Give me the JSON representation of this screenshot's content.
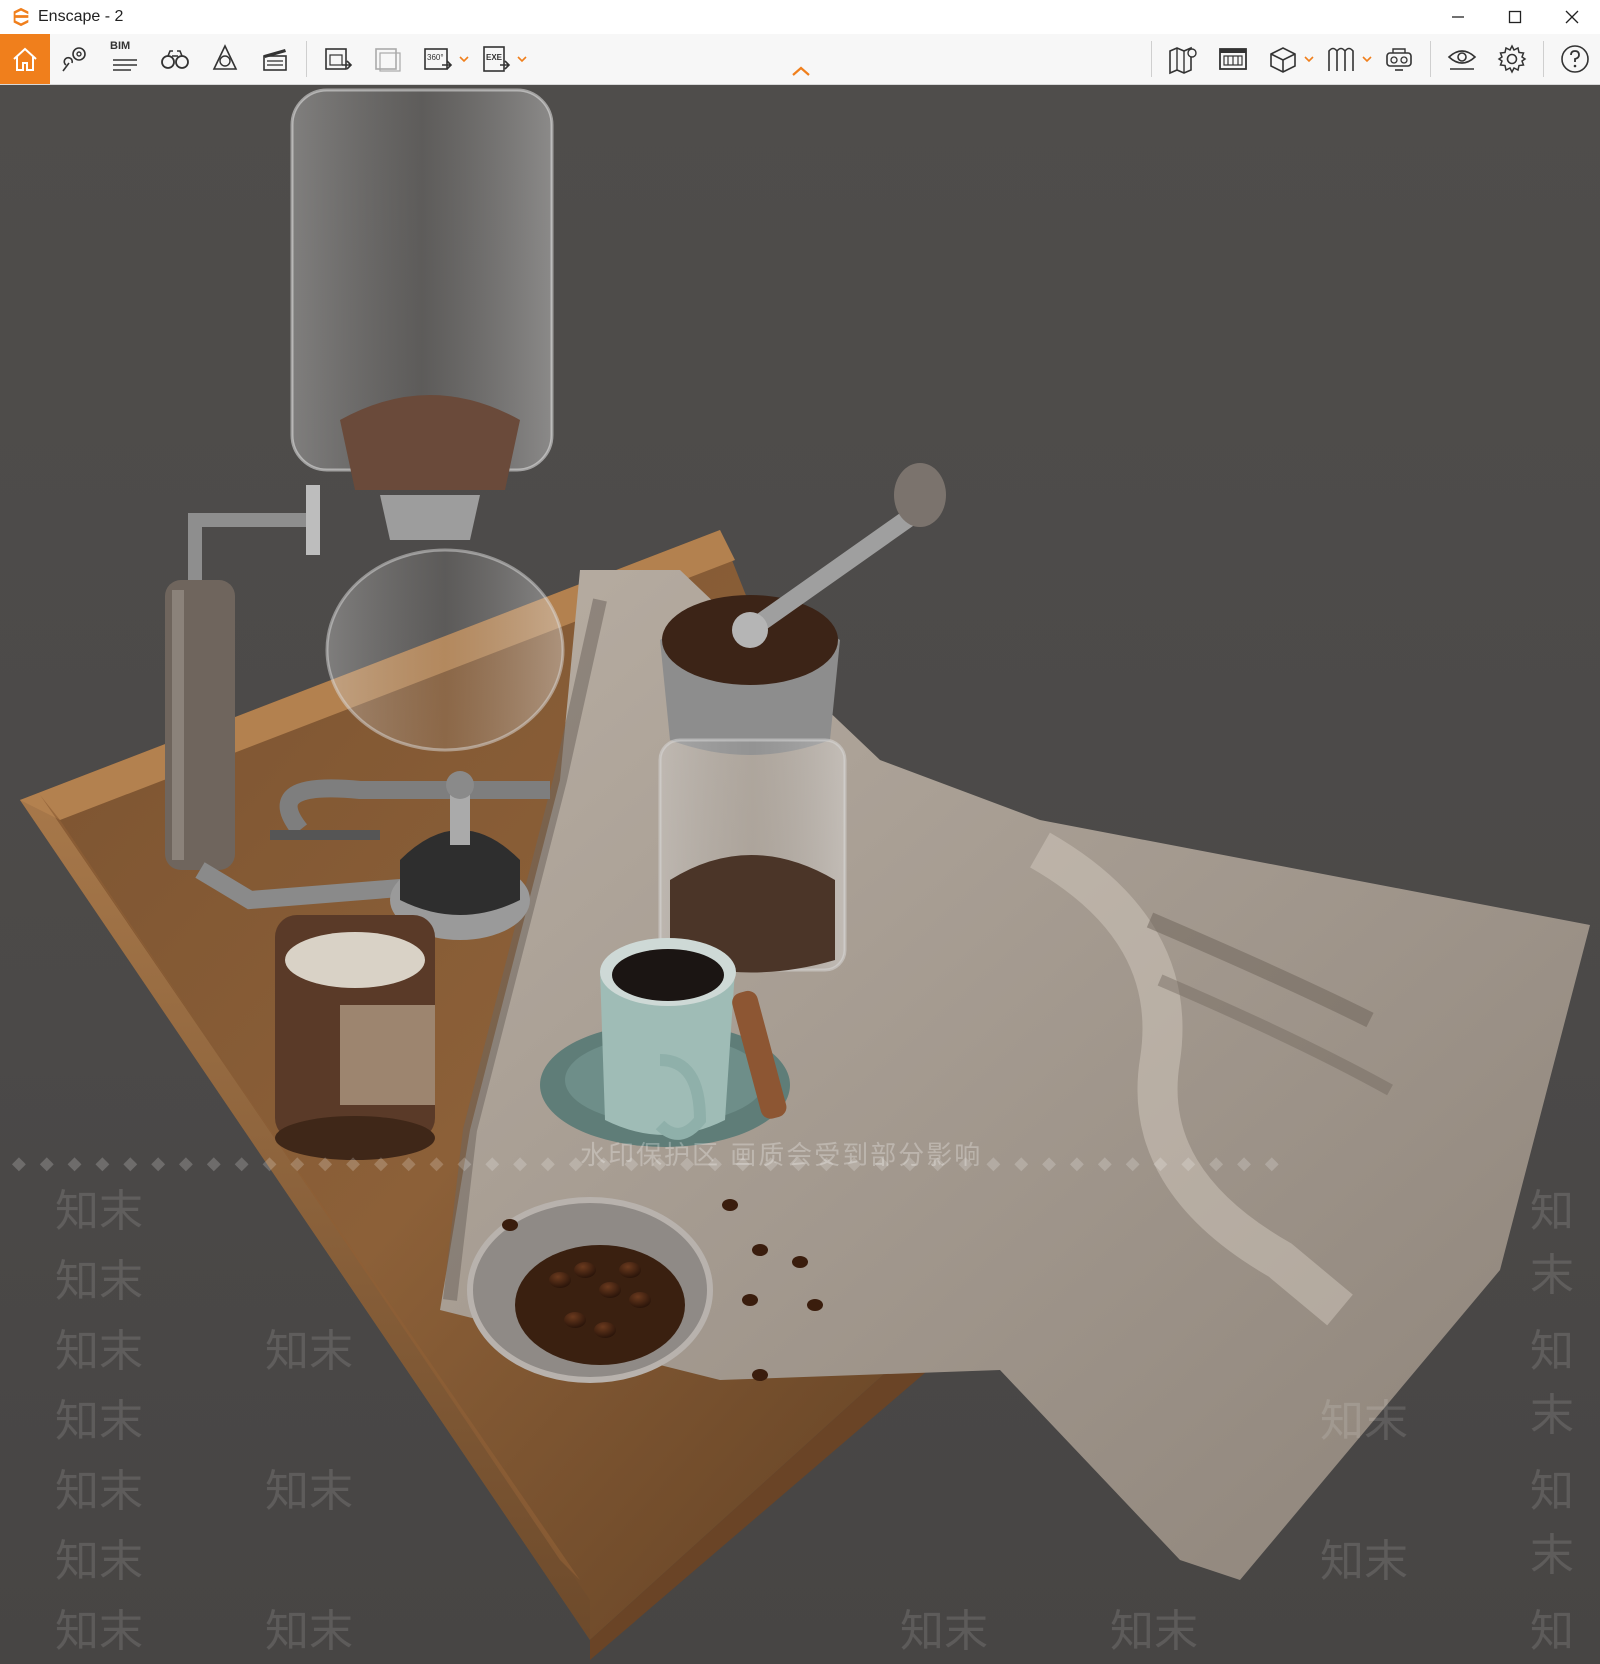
{
  "window": {
    "title": "Enscape - 2",
    "controls": [
      "minimize-icon",
      "maximize-icon",
      "close-icon"
    ]
  },
  "toolbar": {
    "bim_label": "BIM",
    "left_tools": [
      "home-icon",
      "views-icon",
      "bim-info-icon",
      "binoculars-icon",
      "asset-library-icon",
      "video-editor-icon"
    ],
    "export_tools": [
      "screenshot-export-icon",
      "batch-export-icon",
      "panorama-360-icon",
      "exe-export-icon"
    ],
    "panorama_label": "360°",
    "exe_label": "EXE",
    "right_tools": [
      "map-icon",
      "visual-settings-icon",
      "box-icon",
      "ortho-view-icon",
      "vr-headset-icon",
      "eye-icon",
      "settings-icon",
      "help-icon"
    ],
    "accent": "#f07f1c"
  },
  "viewport": {
    "watermark_text": "水印保护区 画质会受到部分影响",
    "watermark_glyph": "知末"
  }
}
